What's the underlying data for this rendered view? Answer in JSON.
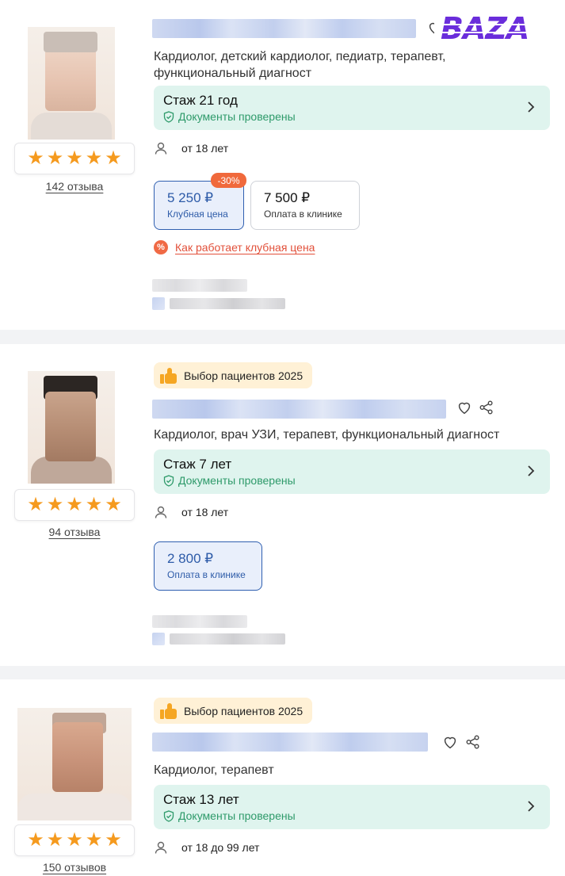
{
  "watermark": {
    "text": "BAZA",
    "color": "#6a2ddb"
  },
  "colors": {
    "accent_blue": "#2d5ba8",
    "verified_green": "#2e9a6a",
    "experience_bg": "#dff4ee",
    "star": "#f59a1e",
    "discount": "#f0693c",
    "link_red": "#e2503a",
    "badge_bg": "#fff1d6"
  },
  "doctors": [
    {
      "rating_stars": 5,
      "reviews": "142 отзыва",
      "badge": null,
      "specialties": "Кардиолог, детский кардиолог, педиатр, терапевт, функциональный диагност",
      "experience": "Стаж 21 год",
      "verified": "Документы проверены",
      "age_range": "от 18 лет",
      "prices": [
        {
          "amount": "5 250 ₽",
          "label": "Клубная цена",
          "discount": "-30%"
        },
        {
          "amount": "7 500 ₽",
          "label": "Оплата в клинике"
        }
      ],
      "club_link": "Как работает клубная цена",
      "club_icon": "percent-icon"
    },
    {
      "rating_stars": 5,
      "reviews": "94 отзыва",
      "badge": "Выбор пациентов 2025",
      "specialties": "Кардиолог, врач УЗИ, терапевт, функциональный диагност",
      "experience": "Стаж 7 лет",
      "verified": "Документы проверены",
      "age_range": "от 18 лет",
      "prices": [
        {
          "amount": "2 800 ₽",
          "label": "Оплата в клинике"
        }
      ]
    },
    {
      "rating_stars": 5,
      "reviews": "150 отзывов",
      "badge": "Выбор пациентов 2025",
      "specialties": "Кардиолог, терапевт",
      "experience": "Стаж 13 лет",
      "verified": "Документы проверены",
      "age_range": "от 18 до 99 лет"
    }
  ],
  "icons": {
    "star": "★",
    "heart": "heart-icon",
    "share": "share-icon",
    "chevron": "chevron-right-icon",
    "user": "user-icon",
    "shield": "shield-check-icon",
    "thumb": "thumbs-up-icon"
  }
}
